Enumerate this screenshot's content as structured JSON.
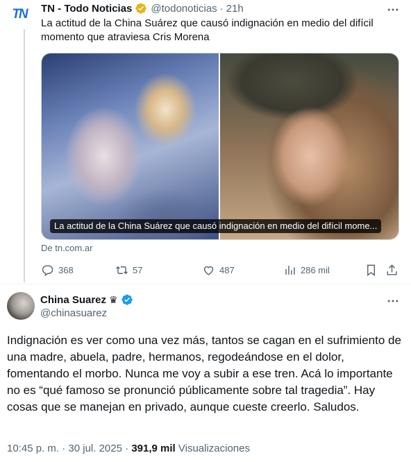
{
  "tweet1": {
    "author": {
      "avatar_text": "TN",
      "name": "TN - Todo Noticias",
      "handle": "@todonoticias",
      "time": "21h",
      "verified_badge": "gold-verified-icon"
    },
    "text": "La actitud de la China Suárez que causó indignación en medio del difícil momento que atraviesa Cris Morena",
    "card": {
      "caption": "La actitud de la China Suárez que causó indignación en medio del difícil mome...",
      "source": "De tn.com.ar"
    },
    "actions": {
      "replies": "368",
      "retweets": "57",
      "likes": "487",
      "views": "286 mil"
    }
  },
  "tweet2": {
    "author": {
      "name": "China Suarez",
      "crown": "♛",
      "handle": "@chinasuarez",
      "verified_badge": "blue-verified-icon"
    },
    "text": "Indignación es ver como una vez más, tantos se cagan en el sufrimiento de una madre, abuela, padre, hermanos, regodeándose en el dolor, fomentando el morbo. Nunca me voy a subir a ese tren. Acá lo importante no es “qué famoso se pronunció públicamente sobre tal tragedia”. Hay cosas que se manejan en privado, aunque cueste creerlo. Saludos.",
    "meta": {
      "time": "10:45 p. m.",
      "separator": "·",
      "date": "30 jul. 2025",
      "views_count": "391,9 mil",
      "views_label": "Visualizaciones"
    }
  },
  "colors": {
    "verified_gold": "#e2b719",
    "verified_blue": "#1d9bf0",
    "secondary_text": "#536471",
    "primary_text": "#0f1419"
  }
}
